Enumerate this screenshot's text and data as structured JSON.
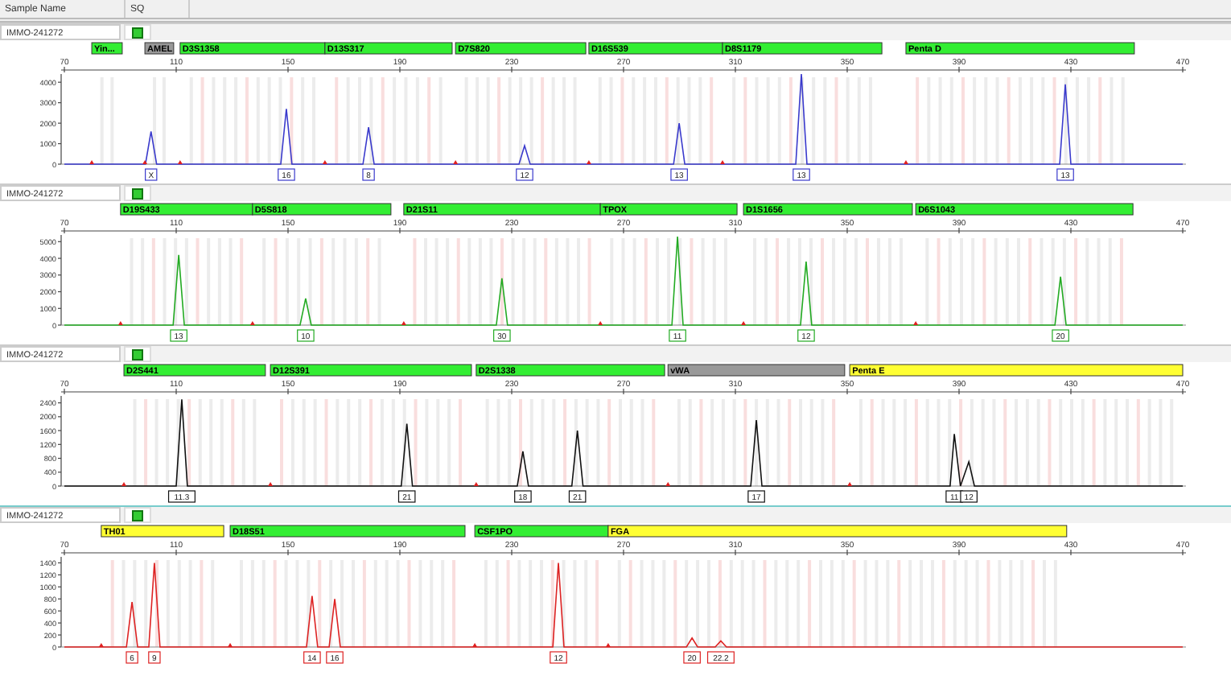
{
  "header": {
    "columns": [
      "Sample Name",
      "SQ"
    ]
  },
  "panels": [
    {
      "sample_name": "IMMO-241272",
      "markers": [
        {
          "label": "Yin...",
          "color": "#33ee33"
        },
        {
          "label": "AMEL",
          "color": "#999999"
        },
        {
          "label": "D3S1358",
          "color": "#33ee33"
        },
        {
          "label": "D13S317",
          "color": "#33ee33"
        },
        {
          "label": "D7S820",
          "color": "#33ee33"
        },
        {
          "label": "D16S539",
          "color": "#33ee33"
        },
        {
          "label": "D8S1179",
          "color": "#33ee33"
        },
        {
          "label": "Penta D",
          "color": "#33ee33"
        }
      ],
      "chart_data": {
        "type": "line",
        "xlim": [
          70,
          470
        ],
        "ylim": [
          0,
          4400
        ],
        "xticks": [
          70,
          110,
          150,
          190,
          230,
          270,
          310,
          350,
          390,
          430,
          470
        ],
        "yticks": [
          0,
          1000,
          2000,
          3000,
          4000
        ],
        "x": [
          70,
          99,
          101,
          103,
          147.4,
          149.4,
          151.4,
          176.8,
          178.8,
          180.8,
          232.6,
          234.6,
          236.6,
          287.9,
          289.9,
          291.9,
          331.6,
          333.6,
          335.6,
          426,
          428,
          430,
          470
        ],
        "series": [
          {
            "color": "#3a3acc",
            "values": [
              0,
              0,
              1600,
              0,
              0,
              2700,
              0,
              0,
              1800,
              0,
              0,
              900,
              0,
              0,
              2000,
              0,
              0,
              4400,
              0,
              0,
              3900,
              0,
              0
            ]
          }
        ],
        "value_labels": [
          null,
          null,
          "X",
          null,
          null,
          "16",
          null,
          null,
          "8",
          null,
          null,
          "12",
          null,
          null,
          "13",
          null,
          null,
          "13",
          null,
          null,
          "13",
          null,
          null
        ]
      }
    },
    {
      "sample_name": "IMMO-241272",
      "markers": [
        {
          "label": "D19S433",
          "color": "#33ee33"
        },
        {
          "label": "D5S818",
          "color": "#33ee33"
        },
        {
          "label": "D21S11",
          "color": "#33ee33"
        },
        {
          "label": "TPOX",
          "color": "#33ee33"
        },
        {
          "label": "D1S1656",
          "color": "#33ee33"
        },
        {
          "label": "D6S1043",
          "color": "#33ee33"
        }
      ],
      "chart_data": {
        "type": "line",
        "xlim": [
          70,
          470
        ],
        "ylim": [
          0,
          5400
        ],
        "xticks": [
          70,
          110,
          150,
          190,
          230,
          270,
          310,
          350,
          390,
          430,
          470
        ],
        "yticks": [
          0,
          1000,
          2000,
          3000,
          4000,
          5000
        ],
        "x": [
          70,
          108.9,
          110.9,
          112.9,
          154.3,
          156.3,
          158.3,
          224.5,
          226.5,
          228.5,
          287.3,
          289.3,
          291.3,
          333.3,
          335.3,
          337.3,
          424.3,
          426.3,
          428.3,
          470
        ],
        "series": [
          {
            "color": "#22aa22",
            "values": [
              0,
              0,
              4200,
              0,
              0,
              1600,
              0,
              0,
              2800,
              0,
              0,
              5300,
              0,
              0,
              3800,
              0,
              0,
              2900,
              0,
              0
            ]
          }
        ],
        "value_labels": [
          null,
          null,
          "13",
          null,
          null,
          "10",
          null,
          null,
          "30",
          null,
          null,
          "11",
          null,
          null,
          "12",
          null,
          null,
          "20",
          null,
          null
        ]
      }
    },
    {
      "sample_name": "IMMO-241272",
      "markers": [
        {
          "label": "D2S441",
          "color": "#33ee33"
        },
        {
          "label": "D12S391",
          "color": "#33ee33"
        },
        {
          "label": "D2S1338",
          "color": "#33ee33"
        },
        {
          "label": "vWA",
          "color": "#999999"
        },
        {
          "label": "Penta E",
          "color": "#ffff33"
        }
      ],
      "chart_data": {
        "type": "line",
        "xlim": [
          70,
          470
        ],
        "ylim": [
          0,
          2600
        ],
        "xticks": [
          70,
          110,
          150,
          190,
          230,
          270,
          310,
          350,
          390,
          430,
          470
        ],
        "yticks": [
          0,
          400,
          800,
          1200,
          1600,
          2000,
          2400
        ],
        "x": [
          70,
          110,
          112,
          114,
          190.5,
          192.5,
          194.5,
          232,
          234,
          236,
          251.5,
          253.5,
          255.5,
          315.5,
          317.5,
          319.5,
          386.8,
          388.3,
          390.5,
          393.5,
          395.5,
          470
        ],
        "series": [
          {
            "color": "#111111",
            "values": [
              0,
              0,
              2500,
              0,
              0,
              1800,
              0,
              0,
              1000,
              0,
              0,
              1600,
              0,
              0,
              1900,
              0,
              0,
              1500,
              0,
              700,
              0,
              0
            ]
          }
        ],
        "value_labels": [
          null,
          null,
          "11.3",
          null,
          null,
          "21",
          null,
          null,
          "18",
          null,
          null,
          "21",
          null,
          null,
          "17",
          null,
          null,
          "11",
          null,
          "12",
          null,
          null
        ]
      }
    },
    {
      "sample_name": "IMMO-241272",
      "markers": [
        {
          "label": "TH01",
          "color": "#ffff33"
        },
        {
          "label": "D18S51",
          "color": "#33ee33"
        },
        {
          "label": "CSF1PO",
          "color": "#33ee33"
        },
        {
          "label": "FGA",
          "color": "#ffff33"
        }
      ],
      "chart_data": {
        "type": "line",
        "xlim": [
          70,
          470
        ],
        "ylim": [
          0,
          1500
        ],
        "xticks": [
          70,
          110,
          150,
          190,
          230,
          270,
          310,
          350,
          390,
          430,
          470
        ],
        "yticks": [
          0,
          200,
          400,
          600,
          800,
          1000,
          1200,
          1400
        ],
        "x": [
          70,
          92.2,
          94.2,
          96.2,
          100.2,
          102.2,
          104.2,
          156.6,
          158.6,
          160.6,
          164.7,
          166.7,
          168.7,
          244.7,
          246.7,
          248.7,
          292.5,
          294.5,
          296.5,
          302.8,
          304.8,
          306.8,
          470
        ],
        "series": [
          {
            "color": "#dd2222",
            "values": [
              0,
              0,
              750,
              0,
              0,
              1400,
              0,
              0,
              850,
              0,
              0,
              800,
              0,
              0,
              1400,
              0,
              0,
              150,
              0,
              0,
              100,
              0,
              0
            ]
          }
        ],
        "value_labels": [
          null,
          null,
          "6",
          null,
          null,
          "9",
          null,
          null,
          "14",
          null,
          null,
          "16",
          null,
          null,
          "12",
          null,
          null,
          "20",
          null,
          null,
          "22.2",
          null,
          null
        ]
      }
    }
  ]
}
